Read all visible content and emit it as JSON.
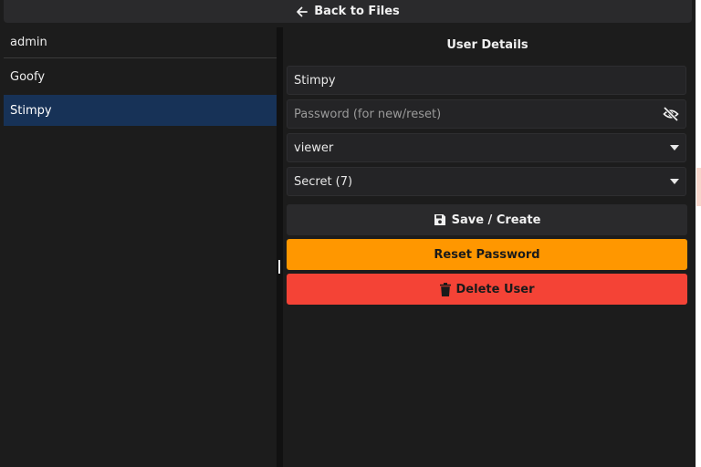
{
  "header": {
    "back_label": "Back to Files"
  },
  "users": [
    {
      "name": "admin"
    },
    {
      "name": "Goofy"
    },
    {
      "name": "Stimpy"
    }
  ],
  "selected_user": "Stimpy",
  "details": {
    "title": "User Details",
    "username_value": "Stimpy",
    "password_placeholder": "Password (for new/reset)",
    "role_value": "viewer",
    "clearance_value": "Secret (7)"
  },
  "actions": {
    "save_label": "Save / Create",
    "reset_label": "Reset Password",
    "delete_label": "Delete User"
  },
  "colors": {
    "selected_bg": "#173257",
    "reset_button": "#ff9700",
    "delete_button": "#f44336"
  },
  "icons": {
    "back": "arrow-left-icon",
    "password_visibility": "eye-off-icon",
    "dropdown": "chevron-down-icon",
    "save": "floppy-disk-icon",
    "delete": "trash-icon"
  }
}
